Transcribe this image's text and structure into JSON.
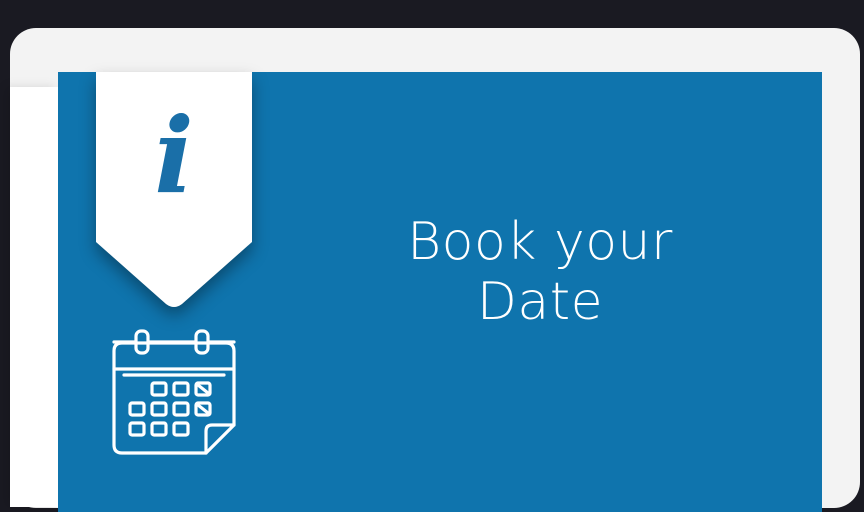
{
  "card": {
    "title_line1": "Book your",
    "title_line2": "Date",
    "info_glyph": "i",
    "ribbon_icon": "info-icon",
    "calendar_icon": "calendar-icon"
  },
  "colors": {
    "banner": "#0f74ad",
    "ribbon": "#ffffff",
    "info_glyph": "#1a6fa8",
    "background": "#1a1a22",
    "card": "#f3f3f3"
  }
}
